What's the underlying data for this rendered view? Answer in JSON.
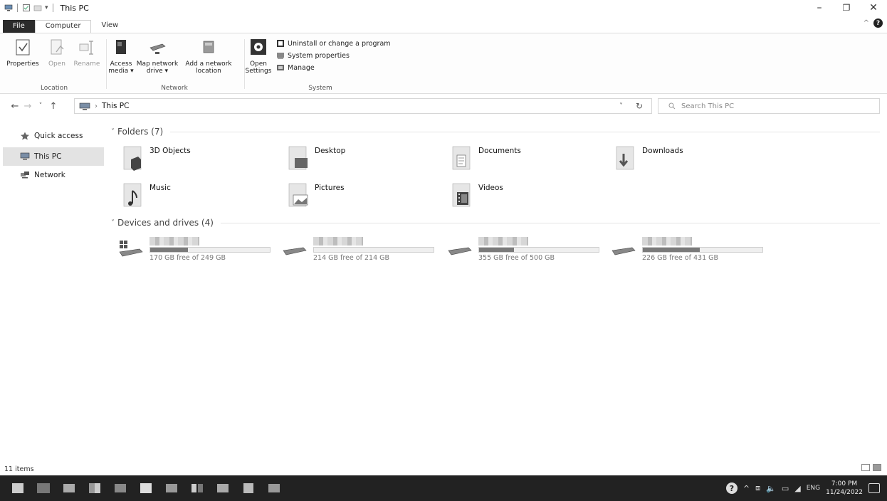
{
  "window": {
    "title": "This PC",
    "controls": {
      "minimize": "–",
      "maximize": "❐",
      "close": "✕"
    }
  },
  "ribbon_tabs": [
    {
      "label": "File"
    },
    {
      "label": "Computer"
    },
    {
      "label": "View"
    }
  ],
  "ribbon": {
    "location": {
      "label": "Location",
      "buttons": [
        "Properties",
        "Open",
        "Rename"
      ]
    },
    "network": {
      "label": "Network",
      "buttons": [
        "Access media ▾",
        "Map network drive ▾",
        "Add a network location"
      ]
    },
    "system": {
      "label": "System",
      "open_settings": "Open Settings",
      "small_buttons": [
        "Uninstall or change a program",
        "System properties",
        "Manage"
      ]
    }
  },
  "address_bar": {
    "breadcrumb": "This PC",
    "search_placeholder": "Search This PC"
  },
  "sidebar": {
    "items": [
      {
        "label": "Quick access"
      },
      {
        "label": "This PC"
      },
      {
        "label": "Network"
      }
    ]
  },
  "folders": {
    "header": "Folders (7)",
    "items": [
      {
        "name": "3D Objects"
      },
      {
        "name": "Desktop"
      },
      {
        "name": "Documents"
      },
      {
        "name": "Downloads"
      },
      {
        "name": "Music"
      },
      {
        "name": "Pictures"
      },
      {
        "name": "Videos"
      }
    ]
  },
  "drives": {
    "header": "Devices and drives (4)",
    "items": [
      {
        "free_text": "170 GB free of 249 GB",
        "used_fraction": 0.317
      },
      {
        "free_text": "214 GB free of 214 GB",
        "used_fraction": 0.0
      },
      {
        "free_text": "355 GB free of 500 GB",
        "used_fraction": 0.29
      },
      {
        "free_text": "226 GB free of 431 GB",
        "used_fraction": 0.476
      }
    ]
  },
  "status": {
    "item_count": "11 items"
  },
  "taskbar": {
    "language": "ENG",
    "time": "7:00 PM",
    "date": "11/24/2022"
  }
}
